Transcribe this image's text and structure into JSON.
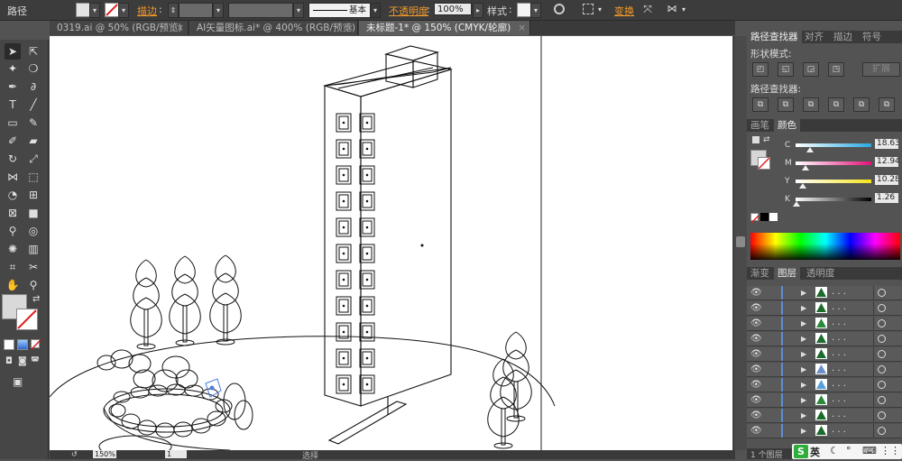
{
  "control_bar": {
    "path_label": "路径",
    "stroke_label": "描边",
    "stroke_preset": "基本",
    "opacity_label": "不透明度",
    "opacity_value": "100%",
    "style_label": "样式",
    "transform_label": "变换"
  },
  "tabs": [
    {
      "label": "0319.ai @ 50% (RGB/预览)",
      "close": "×"
    },
    {
      "label": "AI矢量图标.ai* @ 400% (RGB/预览)",
      "close": "×"
    },
    {
      "label": "未标题-1* @ 150% (CMYK/轮廓)",
      "close": "×"
    }
  ],
  "status_bar": {
    "zoom": "150%",
    "page": "1",
    "mode": "选择"
  },
  "pathfinder_panel": {
    "tabs": [
      "路径查找器",
      "对齐",
      "描边",
      "符号"
    ],
    "shape_modes_label": "形状模式:",
    "expand_label": "扩展",
    "pathfinders_label": "路径查找器:"
  },
  "color_panel": {
    "tabs": [
      "画笔",
      "颜色"
    ],
    "channels": [
      {
        "name": "C",
        "value": "18.63",
        "fraction": 0.19
      },
      {
        "name": "M",
        "value": "12.94",
        "fraction": 0.13
      },
      {
        "name": "Y",
        "value": "10.28",
        "fraction": 0.1
      },
      {
        "name": "K",
        "value": "1.26",
        "fraction": 0.01
      }
    ]
  },
  "layers_panel": {
    "tabs": [
      "渐变",
      "图层",
      "透明度"
    ],
    "rows": [
      {
        "name": ". . ."
      },
      {
        "name": ". . ."
      },
      {
        "name": ". . ."
      },
      {
        "name": ". . ."
      },
      {
        "name": ". . ."
      },
      {
        "name": ". . ."
      },
      {
        "name": ". . ."
      },
      {
        "name": ". . ."
      },
      {
        "name": ". . ."
      },
      {
        "name": ". . ."
      }
    ],
    "footer": "1 个图层"
  },
  "ime": {
    "label": "英"
  },
  "colors": {
    "accent_orange": "#f29a2a",
    "layer_blue": "#5b8fd8",
    "panel_bg": "#535353"
  }
}
